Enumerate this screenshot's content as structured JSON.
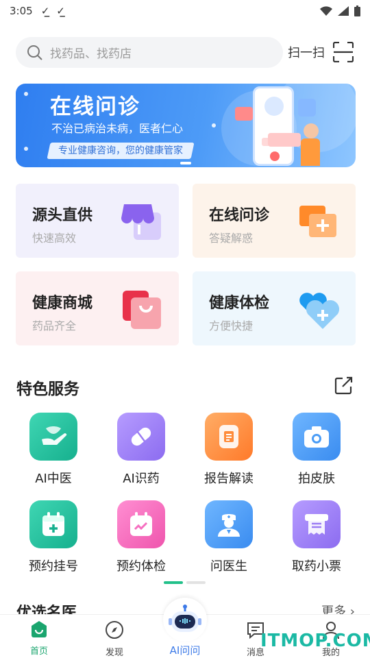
{
  "status_bar": {
    "time": "3:05"
  },
  "search": {
    "placeholder": "找药品、找药店",
    "scan_label": "扫一扫"
  },
  "banner": {
    "title": "在线问诊",
    "subtitle": "不治已病治未病，医者仁心",
    "tag": "专业健康咨询，您的健康管家"
  },
  "cards": [
    {
      "title": "源头直供",
      "subtitle": "快速高效",
      "bg": "#f1f0fc"
    },
    {
      "title": "在线问诊",
      "subtitle": "答疑解惑",
      "bg": "#fdf3ea"
    },
    {
      "title": "健康商城",
      "subtitle": "药品齐全",
      "bg": "#fdf0f1"
    },
    {
      "title": "健康体检",
      "subtitle": "方便快捷",
      "bg": "#eef7fd"
    }
  ],
  "featured": {
    "title": "特色服务",
    "items": [
      {
        "label": "AI中医",
        "icon": "ai-tcm-icon",
        "color": "#22c4a0"
      },
      {
        "label": "AI识药",
        "icon": "ai-pill-icon",
        "color": "#9b7cf3"
      },
      {
        "label": "报告解读",
        "icon": "report-icon",
        "color": "#ff8c3b"
      },
      {
        "label": "拍皮肤",
        "icon": "camera-icon",
        "color": "#4a9cf6"
      },
      {
        "label": "预约挂号",
        "icon": "calendar-plus-icon",
        "color": "#22c4a0"
      },
      {
        "label": "预约体检",
        "icon": "calendar-check-icon",
        "color": "#f66ec0"
      },
      {
        "label": "问医生",
        "icon": "doctor-icon",
        "color": "#4a9cf6"
      },
      {
        "label": "取药小票",
        "icon": "receipt-icon",
        "color": "#9b7cf3"
      }
    ]
  },
  "doctors_section": {
    "title": "优选名医",
    "more": "更多"
  },
  "tabbar": {
    "home": "首页",
    "discover": "发现",
    "ai": "AI问问",
    "messages": "消息",
    "mine": "我的"
  },
  "watermark": "ITMOP.COM"
}
